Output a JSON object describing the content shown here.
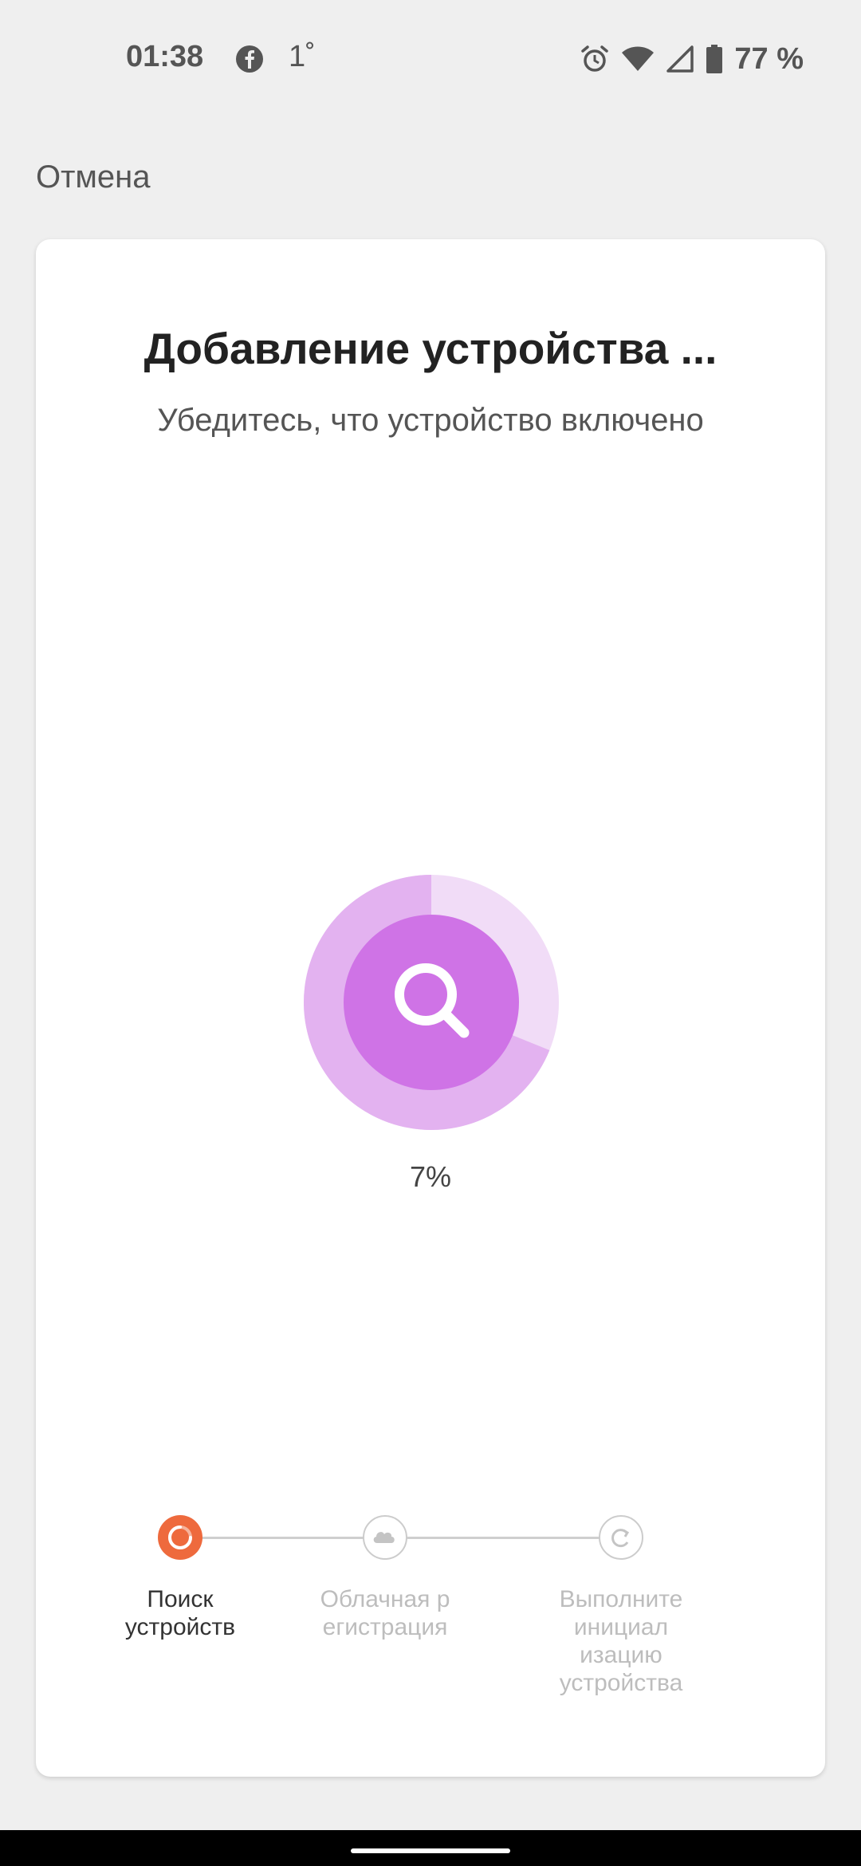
{
  "status_bar": {
    "time": "01:38",
    "temperature": "1˚",
    "battery": "77 %",
    "icons": [
      "facebook-icon",
      "alarm-icon",
      "wifi-icon",
      "signal-icon",
      "battery-icon"
    ]
  },
  "header": {
    "cancel_label": "Отмена"
  },
  "card": {
    "title": "Добавление устройства ...",
    "subtitle": "Убедитесь, что устройство включено"
  },
  "progress": {
    "value": 0.07,
    "label": "7%",
    "icon": "search-icon",
    "color": "#cf73e6"
  },
  "steps": [
    {
      "label_lines": [
        "Поиск",
        "устройств"
      ],
      "icon": "spinner-icon",
      "active": true,
      "color": "#ee6a3d"
    },
    {
      "label_lines": [
        "Облачная р",
        "егистрация"
      ],
      "icon": "cloud-icon",
      "active": false,
      "color": "#bdbdbd"
    },
    {
      "label_lines": [
        "Выполните",
        "инициал",
        "изацию",
        "устройства"
      ],
      "icon": "refresh-icon",
      "active": false,
      "color": "#bdbdbd"
    }
  ]
}
